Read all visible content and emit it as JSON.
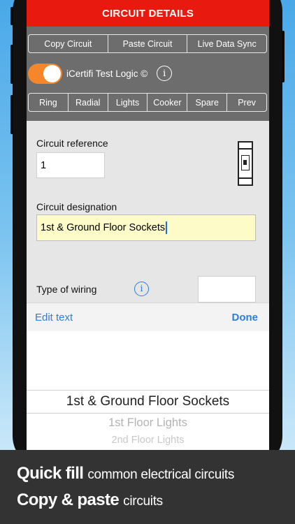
{
  "header": {
    "title": "CIRCUIT DETAILS"
  },
  "actions": [
    "Copy Circuit",
    "Paste Circuit",
    "Live Data Sync"
  ],
  "logic_toggle": {
    "label": "iCertifi Test Logic ©",
    "on": true
  },
  "circuit_types": [
    "Ring",
    "Radial",
    "Lights",
    "Cooker",
    "Spare",
    "Prev"
  ],
  "form": {
    "reference_label": "Circuit reference",
    "reference_value": "1",
    "designation_label": "Circuit designation",
    "designation_value": "1st & Ground Floor Sockets",
    "wiring_label": "Type of wiring",
    "wiring_value": ""
  },
  "keyboard_toolbar": {
    "edit_label": "Edit text",
    "done_label": "Done"
  },
  "picker": {
    "selected": "1st & Ground Floor Sockets",
    "items": [
      "1st Floor Lights",
      "2nd Floor Lights"
    ]
  },
  "caption": {
    "line1_bold": "Quick fill",
    "line1_rest": "common electrical circuits",
    "line2_bold": "Copy & paste",
    "line2_rest": "circuits"
  },
  "colors": {
    "title_bar": "#e8190f",
    "toggle_on": "#f5862a",
    "link_blue": "#2a7de1",
    "panel_grey": "#6d6d6d",
    "caption_bg": "#333333"
  }
}
